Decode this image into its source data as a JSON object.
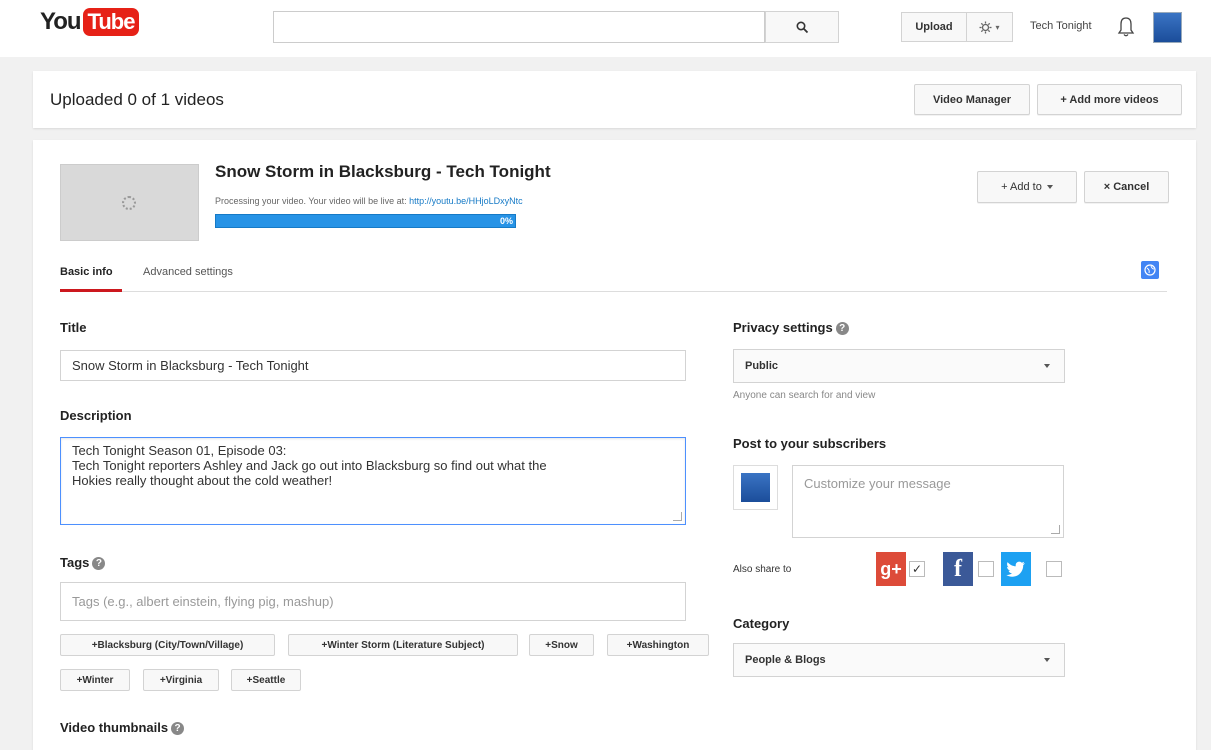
{
  "masthead": {
    "logo_you": "You",
    "logo_tube": "Tube",
    "search_placeholder": "",
    "upload_label": "Upload",
    "gear_caret": "▾",
    "channel_name": "Tech Tonight"
  },
  "status": {
    "text": "Uploaded 0 of 1 videos",
    "video_manager_label": "Video Manager",
    "add_more_label": "+ Add more videos"
  },
  "video": {
    "title": "Snow Storm in Blacksburg - Tech Tonight",
    "processing_text": "Processing your video. Your video will be live at: ",
    "processing_link": "http://youtu.be/HHjoLDxyNtc",
    "progress_percent": 0,
    "progress_label": "0%",
    "add_to_label": "+ Add to",
    "cancel_label": "× Cancel"
  },
  "tabs": [
    "Basic info",
    "Advanced settings"
  ],
  "form": {
    "title_label": "Title",
    "title_value": "Snow Storm in Blacksburg - Tech Tonight",
    "description_label": "Description",
    "description_line1": "Tech Tonight Season 01, Episode 03:",
    "description_line2": "Tech Tonight reporters Ashley and Jack go out into Blacksburg so find out what the",
    "description_line3": "Hokies really thought about the cold weather!",
    "tags_label": "Tags",
    "tags_placeholder": "Tags (e.g., albert einstein, flying pig, mashup)",
    "suggested_tags": [
      "+Blacksburg (City/Town/Village)",
      "+Winter Storm (Literature Subject)",
      "+Snow",
      "+Washington",
      "+Winter",
      "+Virginia",
      "+Seattle"
    ],
    "thumbnails_label": "Video thumbnails"
  },
  "privacy": {
    "label": "Privacy settings",
    "value": "Public",
    "hint": "Anyone can search for and view"
  },
  "subscribers": {
    "label": "Post to your subscribers",
    "placeholder": "Customize your message",
    "also_share": "Also share to",
    "gplus_checked": true,
    "facebook_checked": false,
    "twitter_checked": false
  },
  "category": {
    "label": "Category",
    "value": "People & Blogs"
  },
  "colors": {
    "youtube_red": "#e62117",
    "progress_blue": "#2793e6",
    "tab_underline": "#cc181e",
    "gplus": "#dd4b39",
    "facebook": "#3b5998",
    "twitter": "#1da1f2"
  }
}
